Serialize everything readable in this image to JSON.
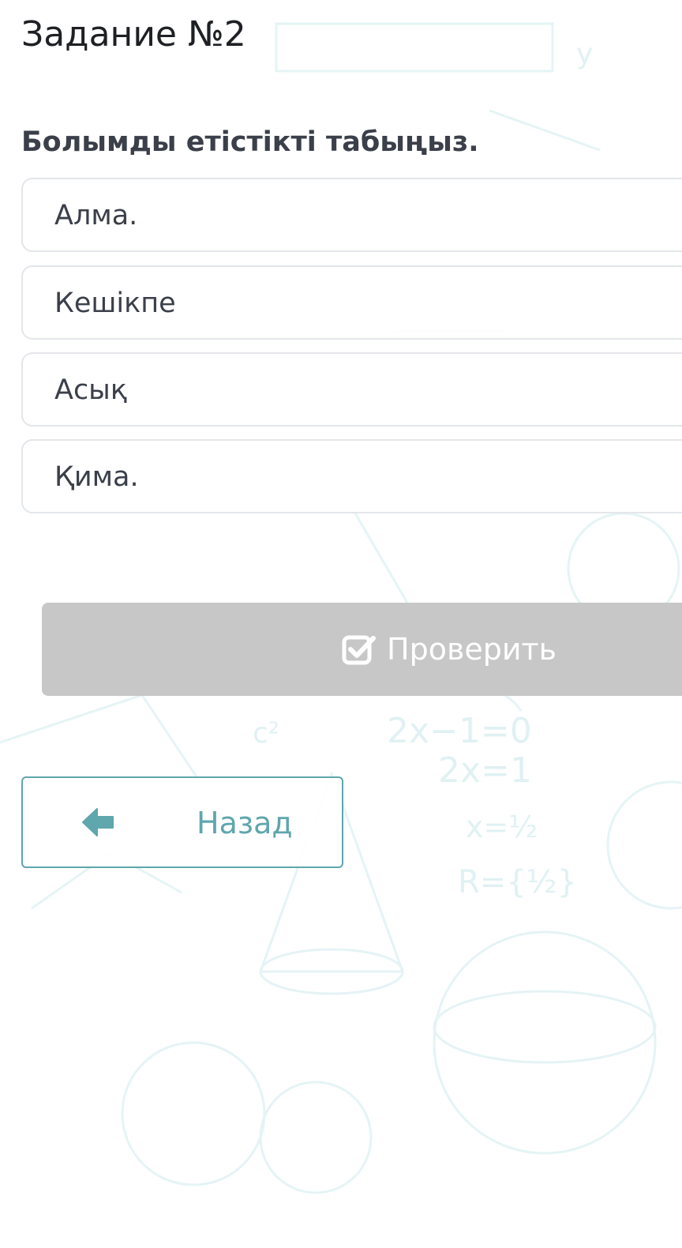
{
  "task": {
    "title": "Задание №2",
    "question": "Болымды етістікті табыңыз."
  },
  "options": [
    {
      "label": "Алма."
    },
    {
      "label": "Кешікпе"
    },
    {
      "label": "Асық"
    },
    {
      "label": "Қима."
    }
  ],
  "buttons": {
    "check": {
      "label": "Проверить",
      "icon": "check-square-icon"
    },
    "back": {
      "label": "Назад",
      "icon": "arrow-left-icon"
    }
  },
  "colors": {
    "check_button_bg": "#c7c7c7",
    "accent_teal": "#5fa6ad",
    "option_border": "#e3e6ea"
  }
}
